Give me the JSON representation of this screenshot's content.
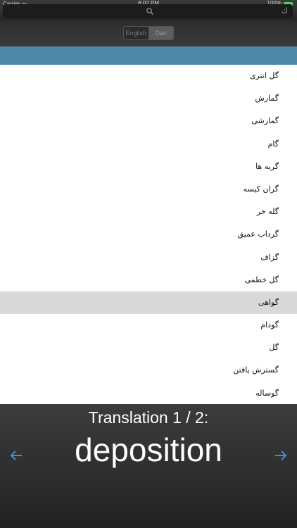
{
  "status": {
    "carrier": "Carrier ᯤ",
    "time": "6:02 PM",
    "battery": "100%"
  },
  "search": {
    "placeholder": "",
    "clear_label": "ك"
  },
  "language_toggle": {
    "options": [
      "English",
      "Dari"
    ],
    "selected": "Dari"
  },
  "words": [
    "گل انتری",
    "گمارش",
    "گمارشی",
    "گام",
    "گربه ها",
    "گران کیسه",
    "گله خر",
    "گرداب عمیق",
    "گزاف",
    "گل خطمی",
    "گواهی",
    "گودام",
    "گل",
    "گسترش یافتن",
    "گوساله"
  ],
  "selected_word": "گواهی",
  "translation": {
    "count_label": "Translation 1 / 2:",
    "word": "deposition"
  },
  "colors": {
    "accent_blue": "#4f89aa",
    "arrow_blue": "#3d8ee6"
  }
}
